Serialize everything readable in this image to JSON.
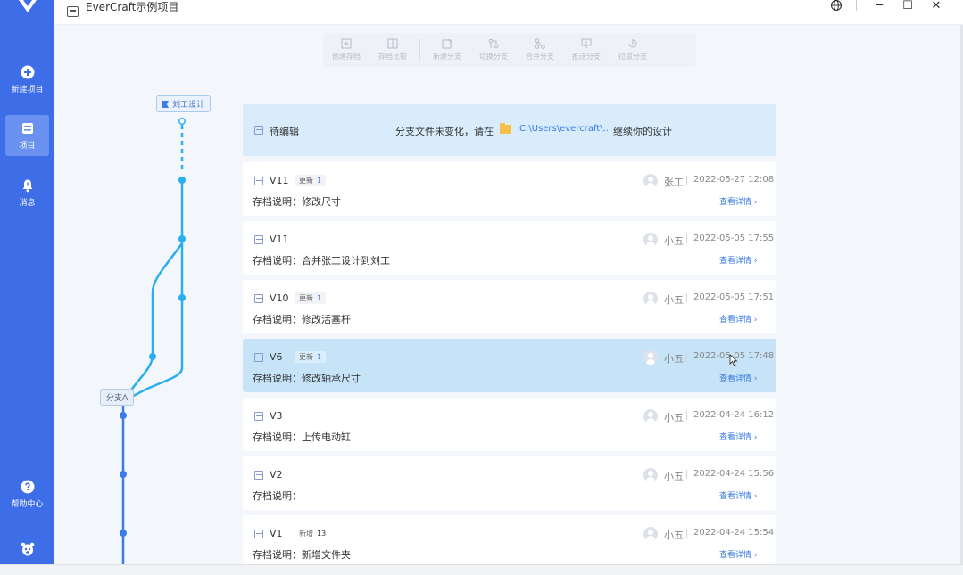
{
  "app": {
    "title": "EverCraft示例项目"
  },
  "sidebar": {
    "items": [
      {
        "label": "新建项目",
        "icon": "plus-circle-icon"
      },
      {
        "label": "项目",
        "icon": "project-icon",
        "active": true
      },
      {
        "label": "消息",
        "icon": "bell-icon"
      },
      {
        "label": "帮助中心",
        "icon": "help-icon"
      }
    ]
  },
  "toolbar": {
    "create_archive": "创建存档",
    "compare_archive": "存档比较",
    "new_branch": "新建分支",
    "switch_branch": "切换分支",
    "merge_branch": "合并分支",
    "push_branch": "推送分支",
    "pull_branch": "拉取分支"
  },
  "graph": {
    "top_tag": "刘工设计",
    "branch_tag": "分支A"
  },
  "pending": {
    "label": "待编辑",
    "message": "分支文件未变化，请在",
    "path": "C:\\Users\\evercraft\\...",
    "tail": "继续你的设计"
  },
  "archives": [
    {
      "version": "V11",
      "badge": "更新",
      "badge_count": "1",
      "note": "存档说明：修改尺寸",
      "user": "张工",
      "time": "2022-05-27 12:08",
      "detail": "查看详情 ›"
    },
    {
      "version": "V11",
      "badge": "",
      "badge_count": "",
      "note": "存档说明：合并张工设计到刘工",
      "user": "小五",
      "time": "2022-05-05 17:55",
      "detail": "查看详情 ›"
    },
    {
      "version": "V10",
      "badge": "更新",
      "badge_count": "1",
      "note": "存档说明：修改活塞杆",
      "user": "小五",
      "time": "2022-05-05 17:51",
      "detail": "查看详情 ›"
    },
    {
      "version": "V6",
      "badge": "更新",
      "badge_count": "1",
      "note": "存档说明：修改轴承尺寸",
      "user": "小五",
      "time": "2022-05-05 17:48",
      "detail": "查看详情 ›",
      "selected": true
    },
    {
      "version": "V3",
      "badge": "",
      "badge_count": "",
      "note": "存档说明：上传电动缸",
      "user": "小五",
      "time": "2022-04-24 16:12",
      "detail": "查看详情 ›"
    },
    {
      "version": "V2",
      "badge": "",
      "badge_count": "",
      "note": "存档说明：",
      "user": "小五",
      "time": "2022-04-24 15:56",
      "detail": "查看详情 ›"
    },
    {
      "version": "V1",
      "badge": "新增",
      "badge_count": "13",
      "note": "存档说明：新增文件夹",
      "user": "小五",
      "time": "2022-04-24 15:54",
      "detail": "查看详情 ›"
    }
  ],
  "colors": {
    "sidebar": "#3d6ee8",
    "branch_line": "#29aef0",
    "main_line": "#3d7be8",
    "link": "#3a7be0"
  }
}
